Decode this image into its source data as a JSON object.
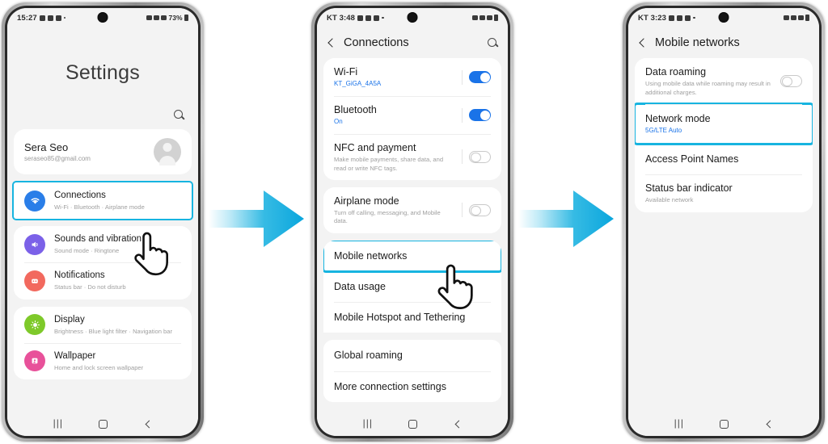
{
  "meta": {
    "accent_cyan": "#17b4e0",
    "accent_blue": "#1a73e8",
    "screen_bg": "#f3f3f3"
  },
  "phone1": {
    "status_bar": {
      "time": "15:27",
      "battery": "73%"
    },
    "title": "Settings",
    "search_icon": "search-icon",
    "profile": {
      "name": "Sera Seo",
      "email": "seraseo85@gmail.com",
      "avatar": "avatar"
    },
    "items": [
      {
        "label": "Connections",
        "sub": "Wi-Fi  ·  Bluetooth  ·  Airplane mode",
        "icon": "wifi-icon",
        "icon_color": "#2a7ee8",
        "highlighted": true
      },
      {
        "label": "Sounds and vibration",
        "sub": "Sound mode  ·  Ringtone",
        "icon": "speaker-icon",
        "icon_color": "#7b61e8",
        "highlighted": false
      },
      {
        "label": "Notifications",
        "sub": "Status bar  ·  Do not disturb",
        "icon": "bell-icon",
        "icon_color": "#f2695e",
        "highlighted": false
      },
      {
        "label": "Display",
        "sub": "Brightness  ·  Blue light filter  ·  Navigation bar",
        "icon": "brightness-icon",
        "icon_color": "#7ec92a",
        "highlighted": false
      },
      {
        "label": "Wallpaper",
        "sub": "Home and lock screen wallpaper",
        "icon": "image-icon",
        "icon_color": "#e8519a",
        "highlighted": false
      }
    ],
    "nav": {
      "recents": "recents-icon",
      "home": "home-icon",
      "back": "back-icon"
    }
  },
  "phone2": {
    "status_bar": {
      "time": "KT 3:48",
      "battery": ""
    },
    "header": {
      "back": "back-icon",
      "title": "Connections",
      "search": "search-icon"
    },
    "items": [
      {
        "label": "Wi-Fi",
        "sub": "KT_GiGA_4A5A",
        "sub_style": "blue",
        "toggle": "on",
        "highlighted": false
      },
      {
        "label": "Bluetooth",
        "sub": "On",
        "sub_style": "blue",
        "toggle": "on",
        "highlighted": false
      },
      {
        "label": "NFC and payment",
        "sub": "Make mobile payments, share data, and read or write NFC tags.",
        "sub_style": "gray",
        "toggle": "off",
        "highlighted": false
      },
      {
        "label": "Airplane mode",
        "sub": "Turn off calling, messaging, and Mobile data.",
        "sub_style": "gray",
        "toggle": "off",
        "highlighted": false
      },
      {
        "label": "Mobile networks",
        "sub": "",
        "sub_style": "",
        "toggle": "none",
        "highlighted": true
      },
      {
        "label": "Data usage",
        "sub": "",
        "sub_style": "",
        "toggle": "none",
        "highlighted": false
      },
      {
        "label": "Mobile Hotspot and Tethering",
        "sub": "",
        "sub_style": "",
        "toggle": "none",
        "highlighted": false
      },
      {
        "label": "Global roaming",
        "sub": "",
        "sub_style": "",
        "toggle": "none",
        "highlighted": false
      },
      {
        "label": "More connection settings",
        "sub": "",
        "sub_style": "",
        "toggle": "none",
        "highlighted": false
      }
    ],
    "nav": {
      "recents": "recents-icon",
      "home": "home-icon",
      "back": "back-icon"
    }
  },
  "phone3": {
    "status_bar": {
      "time": "KT 3:23",
      "battery": ""
    },
    "header": {
      "back": "back-icon",
      "title": "Mobile networks"
    },
    "items": [
      {
        "label": "Data roaming",
        "sub": "Using mobile data while roaming may result in additional charges.",
        "sub_style": "gray",
        "toggle": "off",
        "highlighted": false
      },
      {
        "label": "Network mode",
        "sub": "5G/LTE Auto",
        "sub_style": "blue",
        "toggle": "none",
        "highlighted": true
      },
      {
        "label": "Access Point Names",
        "sub": "",
        "sub_style": "",
        "toggle": "none",
        "highlighted": false
      },
      {
        "label": "Status bar indicator",
        "sub": "Available network",
        "sub_style": "gray",
        "toggle": "none",
        "highlighted": false
      }
    ],
    "nav": {
      "recents": "recents-icon",
      "home": "home-icon",
      "back": "back-icon"
    }
  },
  "arrows": [
    {
      "name": "step-arrow-1",
      "direction": "right"
    },
    {
      "name": "step-arrow-2",
      "direction": "right"
    }
  ],
  "cursors": [
    {
      "name": "hand-cursor-connections"
    },
    {
      "name": "hand-cursor-mobile-networks"
    }
  ]
}
